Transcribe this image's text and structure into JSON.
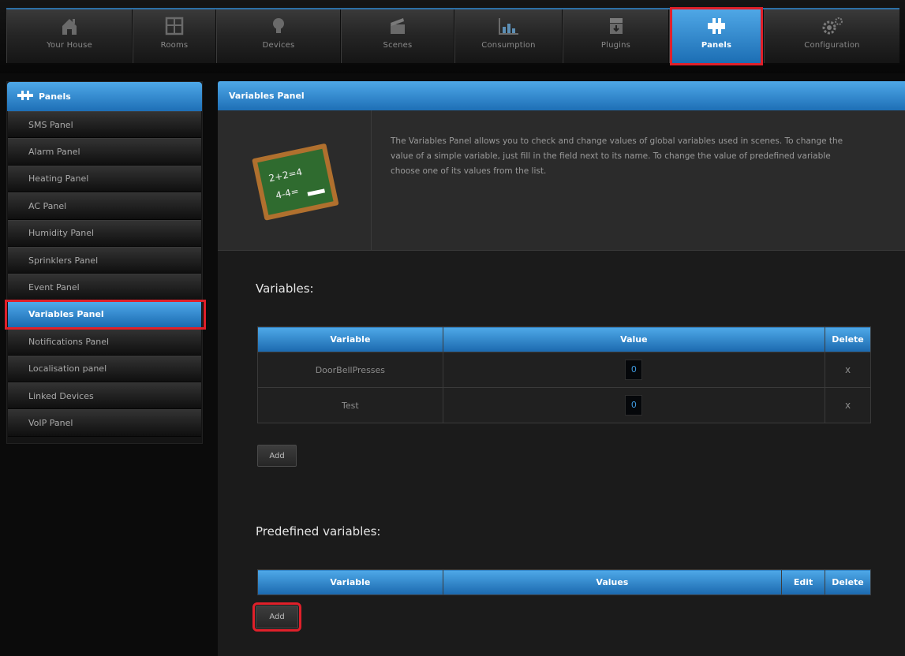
{
  "nav": {
    "items": [
      {
        "label": "Your House",
        "icon": "house-icon"
      },
      {
        "label": "Rooms",
        "icon": "rooms-icon"
      },
      {
        "label": "Devices",
        "icon": "bulb-icon"
      },
      {
        "label": "Scenes",
        "icon": "clapper-icon"
      },
      {
        "label": "Consumption",
        "icon": "chart-icon"
      },
      {
        "label": "Plugins",
        "icon": "plugin-icon"
      },
      {
        "label": "Panels",
        "icon": "puzzle-icon"
      },
      {
        "label": "Configuration",
        "icon": "gears-icon"
      }
    ],
    "active": "Panels"
  },
  "sidebar": {
    "title": "Panels",
    "items": [
      {
        "label": "SMS Panel"
      },
      {
        "label": "Alarm Panel"
      },
      {
        "label": "Heating Panel"
      },
      {
        "label": "AC Panel"
      },
      {
        "label": "Humidity Panel"
      },
      {
        "label": "Sprinklers Panel"
      },
      {
        "label": "Event Panel"
      },
      {
        "label": "Variables Panel"
      },
      {
        "label": "Notifications Panel"
      },
      {
        "label": "Localisation panel"
      },
      {
        "label": "Linked Devices"
      },
      {
        "label": "VoIP Panel"
      }
    ],
    "active": "Variables Panel"
  },
  "main": {
    "title": "Variables Panel",
    "chalkboard_text": [
      "2+2=4",
      "4-4="
    ],
    "description": "The Variables Panel allows you to check and change values of global variables used in scenes. To change the value of a simple variable, just fill in the field next to its name. To change the value of predefined variable choose one of its values from the list.",
    "variables": {
      "heading": "Variables:",
      "columns": [
        "Variable",
        "Value",
        "Delete"
      ],
      "rows": [
        {
          "name": "DoorBellPresses",
          "value": "0",
          "delete": "x"
        },
        {
          "name": "Test",
          "value": "0",
          "delete": "x"
        }
      ],
      "add_label": "Add"
    },
    "predefined": {
      "heading": "Predefined variables:",
      "columns": [
        "Variable",
        "Values",
        "Edit",
        "Delete"
      ],
      "add_label": "Add"
    }
  },
  "colors": {
    "accent_blue": "#2a80c8",
    "highlight_red": "#e0202a",
    "background": "#0b0b0b"
  }
}
